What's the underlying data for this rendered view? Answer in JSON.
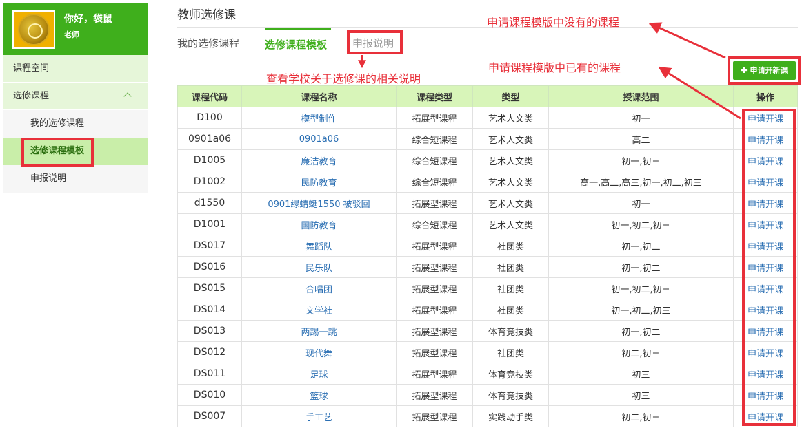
{
  "user": {
    "greeting": "你好，袋鼠",
    "role": "老师"
  },
  "sidebar": {
    "items": [
      {
        "label": "课程空间"
      },
      {
        "label": "选修课程"
      },
      {
        "label": "我的选修课程"
      },
      {
        "label": "选修课程模板"
      },
      {
        "label": "申报说明"
      }
    ]
  },
  "page": {
    "title": "教师选修课"
  },
  "tabs": [
    {
      "label": "我的选修课程"
    },
    {
      "label": "选修课程模板"
    },
    {
      "label": "申报说明"
    }
  ],
  "annotations": {
    "not_in_template": "申请课程模版中没有的课程",
    "in_template": "申请课程模版中已有的课程",
    "see_notes": "查看学校关于选修课的相关说明"
  },
  "toolbar": {
    "add_label": "申请开新课"
  },
  "table": {
    "headers": [
      "课程代码",
      "课程名称",
      "课程类型",
      "类型",
      "授课范围",
      "操作"
    ],
    "rows": [
      {
        "code": "D100",
        "name": "模型制作",
        "course_type": "拓展型课程",
        "category": "艺术人文类",
        "scope": "初一",
        "action": "申请开课"
      },
      {
        "code": "0901a06",
        "name": "0901a06",
        "course_type": "综合短课程",
        "category": "艺术人文类",
        "scope": "高二",
        "action": "申请开课"
      },
      {
        "code": "D1005",
        "name": "廉洁教育",
        "course_type": "综合短课程",
        "category": "艺术人文类",
        "scope": "初一,初三",
        "action": "申请开课"
      },
      {
        "code": "D1002",
        "name": "民防教育",
        "course_type": "综合短课程",
        "category": "艺术人文类",
        "scope": "高一,高二,高三,初一,初二,初三",
        "action": "申请开课"
      },
      {
        "code": "d1550",
        "name": "0901绿蜻蜓1550 被驳回",
        "course_type": "拓展型课程",
        "category": "艺术人文类",
        "scope": "初一",
        "action": "申请开课"
      },
      {
        "code": "D1001",
        "name": "国防教育",
        "course_type": "综合短课程",
        "category": "艺术人文类",
        "scope": "初一,初二,初三",
        "action": "申请开课"
      },
      {
        "code": "DS017",
        "name": "舞蹈队",
        "course_type": "拓展型课程",
        "category": "社团类",
        "scope": "初一,初二",
        "action": "申请开课"
      },
      {
        "code": "DS016",
        "name": "民乐队",
        "course_type": "拓展型课程",
        "category": "社团类",
        "scope": "初一,初二",
        "action": "申请开课"
      },
      {
        "code": "DS015",
        "name": "合唱团",
        "course_type": "拓展型课程",
        "category": "社团类",
        "scope": "初一,初二,初三",
        "action": "申请开课"
      },
      {
        "code": "DS014",
        "name": "文学社",
        "course_type": "拓展型课程",
        "category": "社团类",
        "scope": "初一,初二,初三",
        "action": "申请开课"
      },
      {
        "code": "DS013",
        "name": "两踢一跳",
        "course_type": "拓展型课程",
        "category": "体育竞技类",
        "scope": "初一,初二",
        "action": "申请开课"
      },
      {
        "code": "DS012",
        "name": "现代舞",
        "course_type": "拓展型课程",
        "category": "社团类",
        "scope": "初二,初三",
        "action": "申请开课"
      },
      {
        "code": "DS011",
        "name": "足球",
        "course_type": "拓展型课程",
        "category": "体育竞技类",
        "scope": "初三",
        "action": "申请开课"
      },
      {
        "code": "DS010",
        "name": "篮球",
        "course_type": "拓展型课程",
        "category": "体育竞技类",
        "scope": "初三",
        "action": "申请开课"
      },
      {
        "code": "DS007",
        "name": "手工艺",
        "course_type": "拓展型课程",
        "category": "实践动手类",
        "scope": "初二,初三",
        "action": "申请开课"
      }
    ]
  },
  "colors": {
    "brand_green": "#3faf1c",
    "annotation_red": "#e8303a",
    "link_blue": "#2b6fb3",
    "header_green": "#d8f5b9"
  }
}
